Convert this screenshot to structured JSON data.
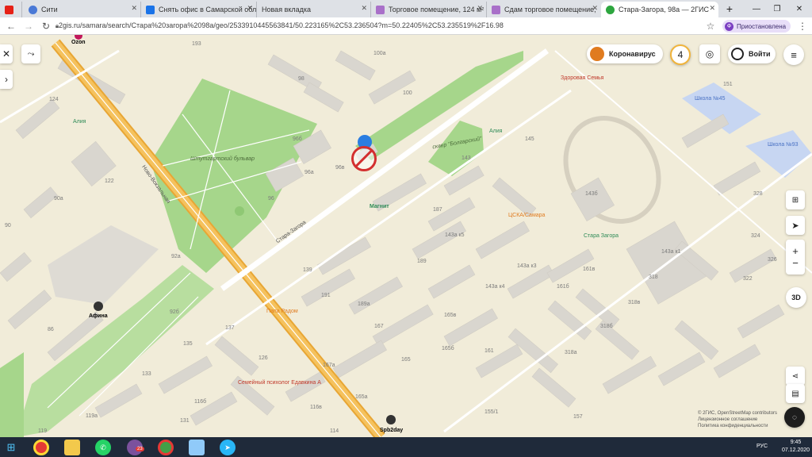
{
  "browser": {
    "tabs": [
      {
        "title": "",
        "icon": "youtube-icon",
        "color": "#e62117"
      },
      {
        "title": "Сити",
        "icon": "chrome-icon",
        "color": "#4a79d6"
      },
      {
        "title": "Снять офис в Самарской обл",
        "icon": "avito-icon",
        "color": "#1a73e8"
      },
      {
        "title": "Новая вкладка",
        "icon": "blank-icon",
        "color": "#dee1e6"
      },
      {
        "title": "Торговое помещение, 124 м²",
        "icon": "cian-icon",
        "color": "#a970c9"
      },
      {
        "title": "Сдам торговое помещение, ",
        "icon": "cian-icon",
        "color": "#a970c9"
      },
      {
        "title": "Стара-Загора, 98а — 2ГИС",
        "icon": "2gis-icon",
        "color": "#2da63f"
      }
    ],
    "url": "2gis.ru/samara/search/Стара%20загора%2098а/geo/2533910445563841/50.223165%2C53.236504?m=50.22405%2C53.235519%2F16.98",
    "profile_badge": "Ф",
    "profile_status": "Приостановлена"
  },
  "map": {
    "controls": {
      "corona_label": "Коронавирус",
      "notifications_count": "4",
      "login_label": "Войти",
      "zoom_in": "+",
      "zoom_out": "−",
      "view_3d": "3D"
    },
    "streets": [
      "Ново-Вокзальная",
      "Стара-Загора",
      "Штутгартский бульвар",
      "сквер \"Болгарский\""
    ],
    "pois": [
      {
        "name": "Ozon",
        "color": "#333333"
      },
      {
        "name": "Здоровая Семья",
        "color": "#c0392b"
      },
      {
        "name": "Алия",
        "color": "#2e8b57"
      },
      {
        "name": "Алия",
        "color": "#2e8b57"
      },
      {
        "name": "Школа №45",
        "color": "#4a72c4"
      },
      {
        "name": "Школа №93",
        "color": "#4a72c4"
      },
      {
        "name": "Магнит",
        "color": "#2e8b57"
      },
      {
        "name": "ЦСКА/Самара",
        "color": "#e07b1f"
      },
      {
        "name": "Стара Загора",
        "color": "#2e8b57"
      },
      {
        "name": "Афина",
        "color": "#333333"
      },
      {
        "name": "Папа Радом",
        "color": "#e07b1f"
      },
      {
        "name": "Семейный психолог Едавкина А",
        "color": "#c0392b"
      },
      {
        "name": "Spb2day",
        "color": "#333333"
      }
    ],
    "building_numbers": [
      "193",
      "100а",
      "98",
      "100",
      "124",
      "96б",
      "96а",
      "96в",
      "96",
      "122",
      "90а",
      "145",
      "143",
      "143б",
      "187",
      "328",
      "151",
      "143а к5",
      "143а к1",
      "189",
      "139",
      "191",
      "92а",
      "92б",
      "137",
      "189а",
      "167",
      "165",
      "167а",
      "165а",
      "135",
      "133",
      "126",
      "116б",
      "116в",
      "131",
      "161б",
      "161в",
      "161",
      "165б",
      "165в",
      "143а к3",
      "143а к4",
      "318",
      "318б",
      "318в",
      "318а",
      "155/1",
      "157",
      "322",
      "326",
      "324",
      "86",
      "90",
      "114",
      "119а",
      "119"
    ],
    "copyright": [
      "© 2ГИС, OpenStreetMap contributors",
      "Лицензионное соглашение",
      "Политика конфиденциальности"
    ]
  },
  "taskbar": {
    "time": "9:45",
    "date": "07.12.2020",
    "lang": "РУС",
    "viber_badge": "23"
  },
  "colors": {
    "road_main": "#f5b94a",
    "park": "#a6d68b",
    "building": "#d9d6cf",
    "school": "#c7d6f2",
    "marker": "#d32f2f",
    "marker_top": "#2a7de1"
  }
}
